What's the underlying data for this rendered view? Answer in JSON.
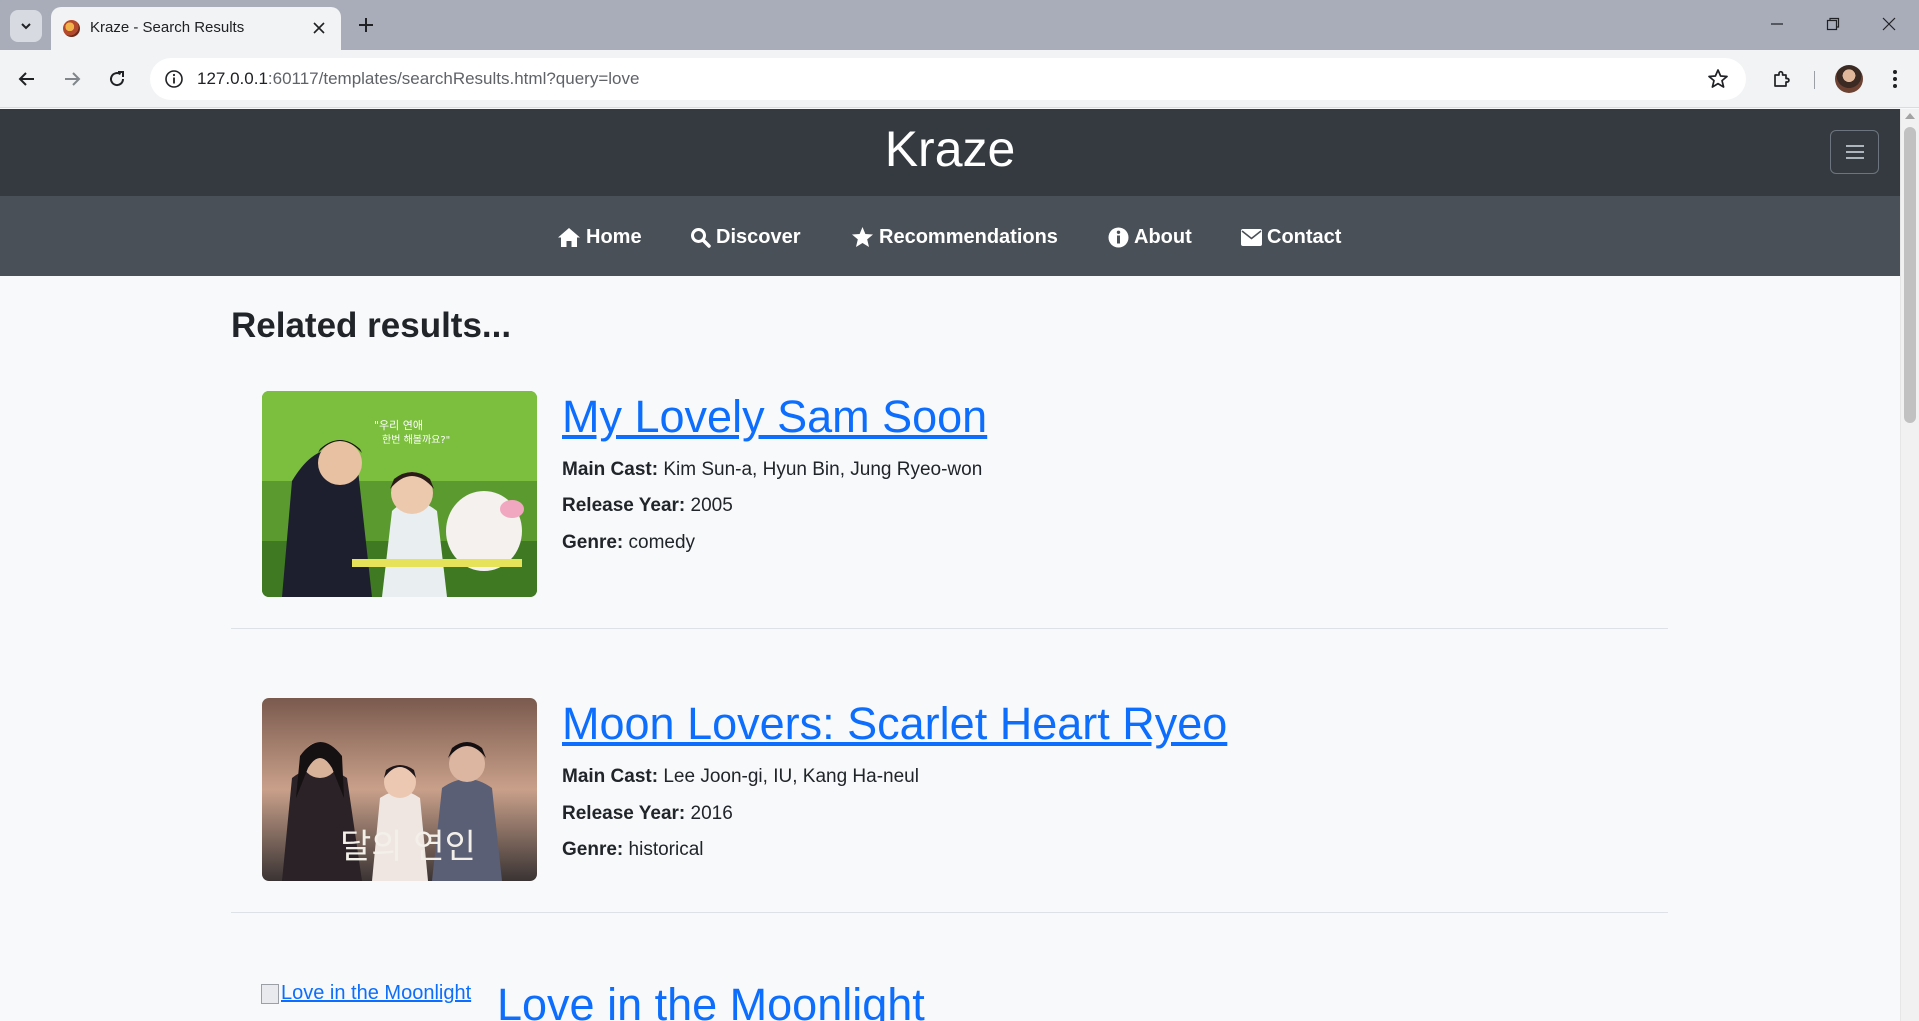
{
  "browser": {
    "tab_title": "Kraze - Search Results",
    "url_host": "127.0.0.1",
    "url_rest": ":60117/templates/searchResults.html?query=love"
  },
  "site": {
    "brand": "Kraze",
    "nav": [
      {
        "label": "Home",
        "icon": "home-icon"
      },
      {
        "label": "Discover",
        "icon": "search-icon"
      },
      {
        "label": "Recommendations",
        "icon": "star-icon"
      },
      {
        "label": "About",
        "icon": "info-icon"
      },
      {
        "label": "Contact",
        "icon": "envelope-icon"
      }
    ]
  },
  "main": {
    "heading": "Related results...",
    "labels": {
      "cast": "Main Cast:",
      "year": "Release Year:",
      "genre": "Genre:"
    },
    "results": [
      {
        "title": "My Lovely Sam Soon",
        "cast": "Kim Sun-a, Hyun Bin, Jung Ryeo-won",
        "year": "2005",
        "genre": "comedy"
      },
      {
        "title": "Moon Lovers: Scarlet Heart Ryeo",
        "cast": "Lee Joon-gi, IU, Kang Ha-neul",
        "year": "2016",
        "genre": "historical"
      },
      {
        "title": "Love in the Moonlight",
        "image_alt": "Love in the Moonlight"
      }
    ]
  },
  "colors": {
    "header_bg": "#343a40",
    "nav_bg": "#495057",
    "link": "#0d6efd",
    "page_bg": "#f8f9fa"
  }
}
